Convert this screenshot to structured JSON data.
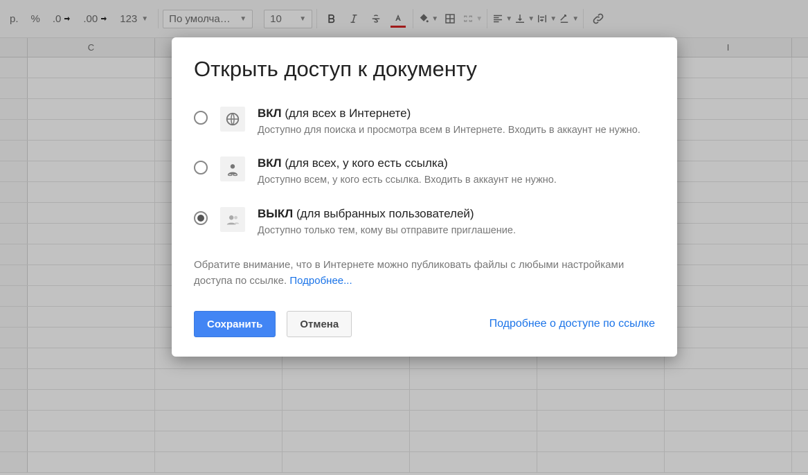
{
  "toolbar": {
    "currency": "р.",
    "percent": "%",
    "dec_dec": ".0",
    "dec_inc": ".00",
    "num_fmt": "123",
    "font_name": "По умолча…",
    "font_size": "10"
  },
  "columns": [
    "C",
    "I"
  ],
  "dialog": {
    "title": "Открыть доступ к документу",
    "options": [
      {
        "bold": "ВКЛ",
        "rest": " (для всех в Интернете)",
        "desc": "Доступно для поиска и просмотра всем в Интернете. Входить в аккаунт не нужно."
      },
      {
        "bold": "ВКЛ",
        "rest": " (для всех, у кого есть ссылка)",
        "desc": "Доступно всем, у кого есть ссылка. Входить в аккаунт не нужно."
      },
      {
        "bold": "ВЫКЛ",
        "rest": " (для выбранных пользователей)",
        "desc": "Доступно только тем, кому вы отправите приглашение."
      }
    ],
    "selected_index": 2,
    "note_before": "Обратите внимание, что в Интернете можно публиковать файлы с любыми настройками доступа по ссылке. ",
    "note_link": "Подробнее...",
    "save": "Сохранить",
    "cancel": "Отмена",
    "more_link": "Подробнее о доступе по ссылке"
  }
}
